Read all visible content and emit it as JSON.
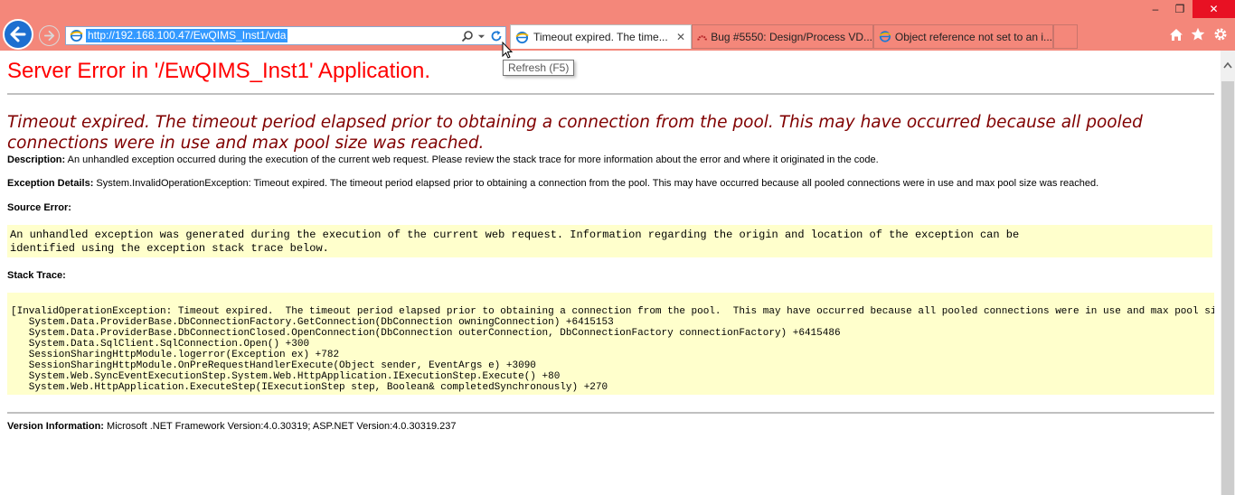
{
  "browser": {
    "address_url": "http://192.168.100.47/EwQIMS_Inst1/vda",
    "tabs": [
      {
        "label": "Timeout expired.  The time..."
      },
      {
        "label": "Bug #5550: Design/Process VD..."
      },
      {
        "label": "Object reference not set to an i..."
      }
    ],
    "tooltip": "Refresh (F5)",
    "window_controls": {
      "minimize": "–",
      "restore": "❐",
      "close": "✕"
    }
  },
  "page": {
    "title": "Server Error in '/EwQIMS_Inst1' Application.",
    "error_message": "Timeout expired.  The timeout period elapsed prior to obtaining a connection from the pool.  This may have occurred because all pooled connections were in use and max pool size was reached.",
    "description_label": "Description:",
    "description_text": "An unhandled exception occurred during the execution of the current web request. Please review the stack trace for more information about the error and where it originated in the code.",
    "exception_label": "Exception Details:",
    "exception_text": "System.InvalidOperationException: Timeout expired.  The timeout period elapsed prior to obtaining a connection from the pool.  This may have occurred because all pooled connections were in use and max pool size was reached.",
    "source_error_label": "Source Error:",
    "source_error_text": "An unhandled exception was generated during the execution of the current web request. Information regarding the origin and location of the exception can be\nidentified using the exception stack trace below.",
    "stack_trace_label": "Stack Trace:",
    "stack_trace_text": "[InvalidOperationException: Timeout expired.  The timeout period elapsed prior to obtaining a connection from the pool.  This may have occurred because all pooled connections were in use and max pool size was reached.]\n   System.Data.ProviderBase.DbConnectionFactory.GetConnection(DbConnection owningConnection) +6415153\n   System.Data.ProviderBase.DbConnectionClosed.OpenConnection(DbConnection outerConnection, DbConnectionFactory connectionFactory) +6415486\n   System.Data.SqlClient.SqlConnection.Open() +300\n   SessionSharingHttpModule.logerror(Exception ex) +782\n   SessionSharingHttpModule.OnPreRequestHandlerExecute(Object sender, EventArgs e) +3090\n   System.Web.SyncEventExecutionStep.System.Web.HttpApplication.IExecutionStep.Execute() +80\n   System.Web.HttpApplication.ExecuteStep(IExecutionStep step, Boolean& completedSynchronously) +270",
    "version_label": "Version Information:",
    "version_text": "Microsoft .NET Framework Version:4.0.30319; ASP.NET Version:4.0.30319.237"
  },
  "colors": {
    "chrome_bg": "#f4877a",
    "title_red": "#ff0000",
    "message_maroon": "#800000",
    "code_bg": "#ffffcc",
    "rule_gray": "#c0c0c0"
  }
}
